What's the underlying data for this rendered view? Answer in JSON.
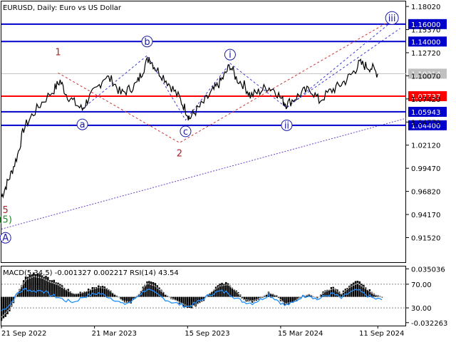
{
  "chart_data": [
    {
      "type": "line",
      "title": "EURUSD, Daily:  Euro vs US Dollar",
      "symbol": "EURUSD",
      "timeframe": "Daily",
      "description": "Euro vs US Dollar",
      "ylim": [
        0.887,
        1.186
      ],
      "y_ticks": [
        "1.18020",
        "1.15370",
        "1.12720",
        "1.10070",
        "1.07420",
        "1.04770",
        "1.02120",
        "0.99470",
        "0.96820",
        "0.94170",
        "0.91520"
      ],
      "y_tick_values": [
        1.1802,
        1.1537,
        1.1272,
        1.1007,
        1.0742,
        1.0477,
        1.0212,
        0.9947,
        0.9682,
        0.9417,
        0.9152
      ],
      "x_ticks": [
        "21 Sep 2022",
        "21 Mar 2023",
        "15 Sep 2023",
        "15 Mar 2024",
        "11 Sep 2024"
      ],
      "grid": false,
      "colors": {
        "price": "#000000",
        "support": "#0000cc",
        "pivot": "#ff0000",
        "current": "#c0c0c0",
        "wave_blue": "#1a1aa6",
        "wave_red": "#b22222",
        "wave_green": "#1e8c1e",
        "channel_red": "#cc3333",
        "channel_blue": "#3a3ad6",
        "trend": "#6b3fc7"
      },
      "levels": [
        {
          "name": "1.16000",
          "value": 1.16,
          "color": "#0000cc"
        },
        {
          "name": "1.14000",
          "value": 1.14,
          "color": "#0000cc"
        },
        {
          "name": "1.10314",
          "value": 1.10314,
          "color": "#c0c0c0"
        },
        {
          "name": "1.07737",
          "value": 1.07737,
          "color": "#ff0000"
        },
        {
          "name": "1.05943",
          "value": 1.05943,
          "color": "#0000cc"
        },
        {
          "name": "1.04400",
          "value": 1.044,
          "color": "#0000cc"
        }
      ],
      "waves": [
        {
          "label": "1",
          "x": 0.14,
          "y": 1.128,
          "style": "plain",
          "color": "#b22222"
        },
        {
          "label": "2",
          "x": 0.44,
          "y": 1.012,
          "style": "plain",
          "color": "#b22222"
        },
        {
          "label": "5",
          "x": 0.01,
          "y": 0.947,
          "style": "plain",
          "color": "#b22222"
        },
        {
          "label": "(5)",
          "x": 0.01,
          "y": 0.936,
          "style": "plain",
          "color": "#1e8c1e"
        },
        {
          "label": "A",
          "x": 0.01,
          "y": 0.915,
          "style": "circle",
          "color": "#1a1aa6"
        },
        {
          "label": "a",
          "x": 0.2,
          "y": 1.045,
          "style": "circle",
          "color": "#1a1aa6"
        },
        {
          "label": "b",
          "x": 0.36,
          "y": 1.14,
          "style": "circle",
          "color": "#1a1aa6"
        },
        {
          "label": "c",
          "x": 0.455,
          "y": 1.037,
          "style": "circle",
          "color": "#1a1aa6"
        },
        {
          "label": "i",
          "x": 0.565,
          "y": 1.125,
          "style": "circle",
          "color": "#1a1aa6"
        },
        {
          "label": "ii",
          "x": 0.705,
          "y": 1.044,
          "style": "circle",
          "color": "#1a1aa6"
        },
        {
          "label": "iii",
          "x": 0.965,
          "y": 1.167,
          "style": "circle",
          "color": "#1a1aa6"
        }
      ],
      "price_path": [
        [
          0.0,
          0.962
        ],
        [
          0.012,
          0.975
        ],
        [
          0.025,
          0.99
        ],
        [
          0.04,
          1.01
        ],
        [
          0.055,
          1.04
        ],
        [
          0.075,
          1.055
        ],
        [
          0.1,
          1.07
        ],
        [
          0.13,
          1.085
        ],
        [
          0.145,
          1.095
        ],
        [
          0.16,
          1.08
        ],
        [
          0.18,
          1.07
        ],
        [
          0.2,
          1.062
        ],
        [
          0.215,
          1.075
        ],
        [
          0.235,
          1.085
        ],
        [
          0.255,
          1.1
        ],
        [
          0.275,
          1.095
        ],
        [
          0.295,
          1.08
        ],
        [
          0.315,
          1.085
        ],
        [
          0.335,
          1.092
        ],
        [
          0.35,
          1.108
        ],
        [
          0.365,
          1.122
        ],
        [
          0.38,
          1.11
        ],
        [
          0.4,
          1.1
        ],
        [
          0.42,
          1.088
        ],
        [
          0.44,
          1.075
        ],
        [
          0.455,
          1.062
        ],
        [
          0.465,
          1.052
        ],
        [
          0.48,
          1.06
        ],
        [
          0.5,
          1.07
        ],
        [
          0.52,
          1.082
        ],
        [
          0.535,
          1.09
        ],
        [
          0.55,
          1.1
        ],
        [
          0.565,
          1.113
        ],
        [
          0.58,
          1.098
        ],
        [
          0.6,
          1.09
        ],
        [
          0.615,
          1.078
        ],
        [
          0.635,
          1.082
        ],
        [
          0.655,
          1.088
        ],
        [
          0.675,
          1.085
        ],
        [
          0.695,
          1.072
        ],
        [
          0.705,
          1.068
        ],
        [
          0.725,
          1.075
        ],
        [
          0.745,
          1.082
        ],
        [
          0.765,
          1.085
        ],
        [
          0.785,
          1.072
        ],
        [
          0.81,
          1.082
        ],
        [
          0.83,
          1.088
        ],
        [
          0.85,
          1.095
        ],
        [
          0.87,
          1.105
        ],
        [
          0.885,
          1.115
        ],
        [
          0.9,
          1.112
        ],
        [
          0.915,
          1.11
        ],
        [
          0.93,
          1.103
        ]
      ],
      "blue_zigzag": [
        [
          0.2,
          1.063
        ],
        [
          0.36,
          1.124
        ],
        [
          0.455,
          1.05
        ],
        [
          0.565,
          1.115
        ],
        [
          0.705,
          1.064
        ],
        [
          0.97,
          1.165
        ]
      ],
      "red_zigzag": [
        [
          0.14,
          1.104
        ],
        [
          0.44,
          1.024
        ],
        [
          0.965,
          1.165
        ]
      ],
      "channel_blue_line": [
        [
          0.705,
          1.065
        ],
        [
          0.985,
          1.155
        ]
      ],
      "trend_line": [
        [
          0.0,
          0.925
        ],
        [
          1.0,
          1.052
        ]
      ]
    },
    {
      "type": "line",
      "title": "MACD(5,34,5) -0.001327 0.002217 RSI(14) 43.54",
      "indicator": "MACD(5,34,5)",
      "macd_value": "-0.001327",
      "signal_value": "0.002217",
      "rsi_label": "RSI(14)",
      "rsi_value": "43.54",
      "ylim": [
        -0.036,
        0.038
      ],
      "y_ticks": [
        "0.035036",
        "70.00",
        "30.00",
        "-0.032263"
      ],
      "colors": {
        "histogram": "#000000",
        "rsi": "#1e90ff",
        "signal": "#c0c0c0"
      },
      "rsi_levels": [
        70,
        30
      ],
      "macd_path": [
        [
          0.0,
          -0.03
        ],
        [
          0.02,
          -0.018
        ],
        [
          0.04,
          0.005
        ],
        [
          0.06,
          0.025
        ],
        [
          0.08,
          0.03
        ],
        [
          0.1,
          0.028
        ],
        [
          0.12,
          0.022
        ],
        [
          0.14,
          0.018
        ],
        [
          0.16,
          0.01
        ],
        [
          0.18,
          0.004
        ],
        [
          0.2,
          0.006
        ],
        [
          0.22,
          0.01
        ],
        [
          0.24,
          0.014
        ],
        [
          0.26,
          0.012
        ],
        [
          0.28,
          0.004
        ],
        [
          0.3,
          -0.006
        ],
        [
          0.32,
          -0.008
        ],
        [
          0.34,
          0.004
        ],
        [
          0.36,
          0.02
        ],
        [
          0.38,
          0.016
        ],
        [
          0.4,
          0.006
        ],
        [
          0.42,
          -0.002
        ],
        [
          0.44,
          -0.008
        ],
        [
          0.46,
          -0.014
        ],
        [
          0.48,
          -0.012
        ],
        [
          0.5,
          -0.004
        ],
        [
          0.52,
          0.008
        ],
        [
          0.54,
          0.016
        ],
        [
          0.56,
          0.018
        ],
        [
          0.58,
          0.008
        ],
        [
          0.6,
          -0.004
        ],
        [
          0.62,
          -0.006
        ],
        [
          0.64,
          -0.002
        ],
        [
          0.66,
          0.006
        ],
        [
          0.68,
          0.002
        ],
        [
          0.7,
          -0.01
        ],
        [
          0.72,
          -0.008
        ],
        [
          0.74,
          0.0
        ],
        [
          0.76,
          0.004
        ],
        [
          0.78,
          -0.002
        ],
        [
          0.8,
          0.008
        ],
        [
          0.82,
          0.012
        ],
        [
          0.84,
          0.004
        ],
        [
          0.86,
          0.014
        ],
        [
          0.88,
          0.02
        ],
        [
          0.9,
          0.012
        ],
        [
          0.92,
          0.004
        ],
        [
          0.94,
          -0.001
        ]
      ],
      "rsi_path": [
        [
          0.0,
          25
        ],
        [
          0.02,
          35
        ],
        [
          0.04,
          55
        ],
        [
          0.06,
          62
        ],
        [
          0.08,
          58
        ],
        [
          0.1,
          60
        ],
        [
          0.12,
          52
        ],
        [
          0.14,
          48
        ],
        [
          0.16,
          42
        ],
        [
          0.18,
          40
        ],
        [
          0.2,
          48
        ],
        [
          0.22,
          52
        ],
        [
          0.24,
          55
        ],
        [
          0.26,
          50
        ],
        [
          0.28,
          44
        ],
        [
          0.3,
          36
        ],
        [
          0.32,
          40
        ],
        [
          0.34,
          52
        ],
        [
          0.36,
          62
        ],
        [
          0.38,
          54
        ],
        [
          0.4,
          46
        ],
        [
          0.42,
          40
        ],
        [
          0.44,
          36
        ],
        [
          0.46,
          32
        ],
        [
          0.48,
          38
        ],
        [
          0.5,
          46
        ],
        [
          0.52,
          54
        ],
        [
          0.54,
          58
        ],
        [
          0.56,
          56
        ],
        [
          0.58,
          46
        ],
        [
          0.6,
          40
        ],
        [
          0.62,
          38
        ],
        [
          0.64,
          44
        ],
        [
          0.66,
          52
        ],
        [
          0.68,
          44
        ],
        [
          0.7,
          34
        ],
        [
          0.72,
          38
        ],
        [
          0.74,
          48
        ],
        [
          0.76,
          52
        ],
        [
          0.78,
          44
        ],
        [
          0.8,
          50
        ],
        [
          0.82,
          54
        ],
        [
          0.84,
          46
        ],
        [
          0.86,
          56
        ],
        [
          0.88,
          60
        ],
        [
          0.9,
          52
        ],
        [
          0.92,
          46
        ],
        [
          0.94,
          43.5
        ]
      ]
    }
  ]
}
